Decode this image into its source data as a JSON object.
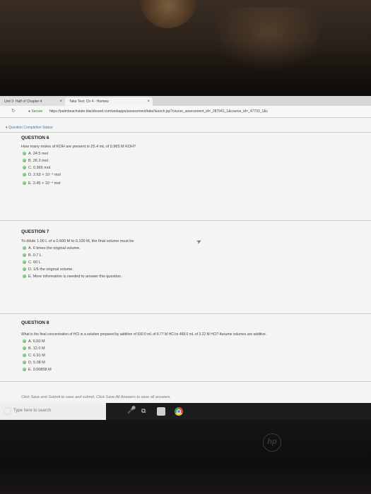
{
  "browser": {
    "tabs": [
      {
        "label": "Unit 3: Half of Chapter 4"
      },
      {
        "label": "Take Test: Ch 4 - Homew"
      }
    ],
    "secure_label": "Secure",
    "url": "https://palmbeachstate.blackboard.com/webapps/assessment/take/launch.jsp?course_assessment_id=_287941_1&course_id=_47733_1&c"
  },
  "page": {
    "status_link": "Question Completion Status:",
    "questions": [
      {
        "title": "QUESTION 6",
        "text": "How many moles of KOH are present in 25.4 mL of 0.965 M KOH?",
        "options": [
          {
            "label": "A. 24.5 mol"
          },
          {
            "label": "B. 26.3 mol"
          },
          {
            "label": "C. 0.965 mol"
          },
          {
            "label": "D. 2.63 × 10⁻⁴ mol"
          },
          {
            "label": "E. 2.45 × 10⁻⁴ mol"
          }
        ]
      },
      {
        "title": "QUESTION 7",
        "text": "To dilute 1.00 L of a 0.600 M to 0.100 M, the final volume must be",
        "options": [
          {
            "label": "A. 6 times the original volume."
          },
          {
            "label": "B. 0.7 L"
          },
          {
            "label": "C. 60 L"
          },
          {
            "label": "D. 1/6 the original volume."
          },
          {
            "label": "E. More information is needed to answer this question."
          }
        ]
      },
      {
        "title": "QUESTION 8",
        "text": "What is the final concentration of HCl in a solution prepared by addition of 930.0 mL of 8.77 M HCl to 468.0 mL of 3.22 M HCl? Assume volumes are additive.",
        "options": [
          {
            "label": "A. 6.00 M"
          },
          {
            "label": "B. 12.0 M"
          },
          {
            "label": "C. 6.91 M"
          },
          {
            "label": "D. 5.08 M"
          },
          {
            "label": "E. 0.00858 M"
          }
        ]
      }
    ],
    "instructions": "Click Save and Submit to save and submit. Click Save All Answers to save all answers."
  },
  "taskbar": {
    "search_placeholder": "Type here to search"
  },
  "colors": {
    "radio": "#5ea862",
    "link": "#4a74a8",
    "taskbar": "#1c1c1c"
  }
}
